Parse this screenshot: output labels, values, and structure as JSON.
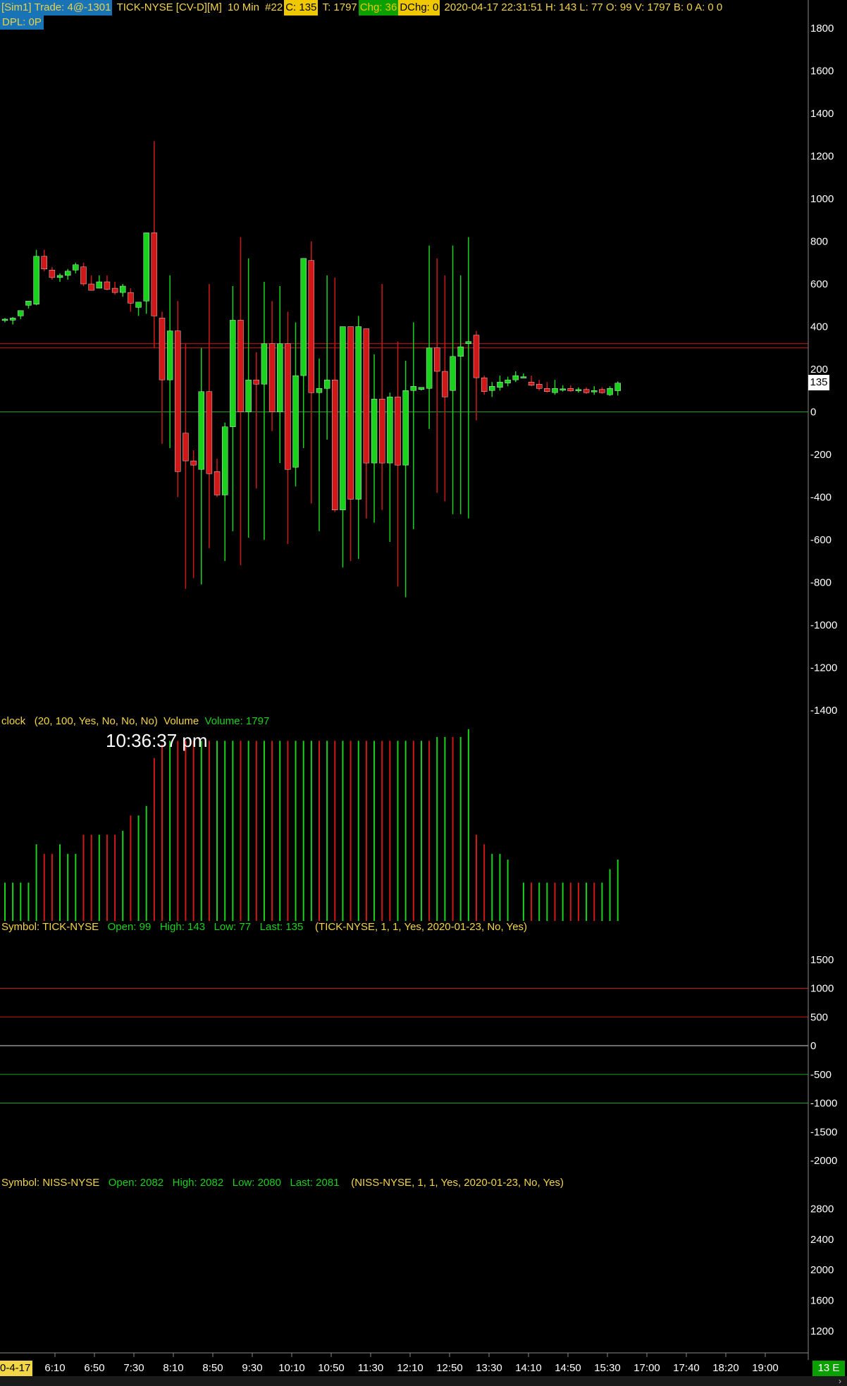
{
  "topbar": {
    "account": "[Sim1]",
    "trade": "Trade: 4@-1301",
    "symbol": "TICK-NYSE [CV-D][M]",
    "interval": "10 Min",
    "bar_number": "#22",
    "close": "C: 135",
    "ticks": "T: 1797",
    "change": "Chg: 36",
    "dchange": "DChg: 0",
    "stats": "2020-04-17 22:31:51 H: 143 L: 77 O: 99 V: 1797 B: 0 A: 0 0"
  },
  "dpl": "DPL: 0P",
  "price_axis": [
    "1800",
    "1600",
    "1400",
    "1200",
    "1000",
    "800",
    "600",
    "400",
    "200",
    "0",
    "-200",
    "-400",
    "-600",
    "-800",
    "-1000",
    "-1200",
    "-1400"
  ],
  "last_price_badge": "135",
  "volume_panel": {
    "label_name": "clock",
    "label_params": "(20, 100, Yes, No, No, No)",
    "label_volume": "Volume",
    "label_value": "Volume: 1797",
    "clock_time": "10:36:37 pm"
  },
  "tick_panel": {
    "label_symbol": "Symbol: TICK-NYSE",
    "label_open": "Open: 99",
    "label_high": "High: 143",
    "label_low": "Low: 77",
    "label_last": "Last: 135",
    "label_params": "(TICK-NYSE, 1, 1, Yes, 2020-01-23, No, Yes)",
    "axis": [
      "1500",
      "1000",
      "500",
      "0",
      "-500",
      "-1000",
      "-1500",
      "-2000"
    ]
  },
  "niss_panel": {
    "label_symbol": "Symbol: NISS-NYSE",
    "label_open": "Open: 2082",
    "label_high": "High: 2082",
    "label_low": "Low: 2080",
    "label_last": "Last: 2081",
    "label_params": "(NISS-NYSE, 1, 1, Yes, 2020-01-23, No, Yes)",
    "axis": [
      "2800",
      "2400",
      "2000",
      "1600",
      "1200"
    ]
  },
  "time_axis": [
    "6:10",
    "6:50",
    "7:30",
    "8:10",
    "8:50",
    "9:30",
    "10:10",
    "10:50",
    "11:30",
    "12:10",
    "12:50",
    "13:30",
    "14:10",
    "14:50",
    "15:30",
    "17:00",
    "17:40",
    "18:20",
    "19:00"
  ],
  "date_badge": "0-4-17",
  "scroll_badge": "13 E",
  "colors": {
    "up": "#19d21c",
    "down": "#d01818",
    "grid_red": "#d01818",
    "grid_green": "#19a01c",
    "axis_text": "#ffffff"
  },
  "chart_data": {
    "type": "candlestick",
    "ylim": [
      -1400,
      1800
    ],
    "candles": [
      {
        "o": 430,
        "h": 440,
        "l": 420,
        "c": 435
      },
      {
        "o": 430,
        "h": 445,
        "l": 410,
        "c": 440
      },
      {
        "o": 450,
        "h": 465,
        "l": 435,
        "c": 475
      },
      {
        "o": 500,
        "h": 520,
        "l": 485,
        "c": 520
      },
      {
        "o": 505,
        "h": 760,
        "l": 500,
        "c": 730
      },
      {
        "o": 730,
        "h": 760,
        "l": 660,
        "c": 670
      },
      {
        "o": 665,
        "h": 680,
        "l": 620,
        "c": 630
      },
      {
        "o": 630,
        "h": 650,
        "l": 610,
        "c": 640
      },
      {
        "o": 640,
        "h": 670,
        "l": 620,
        "c": 660
      },
      {
        "o": 665,
        "h": 700,
        "l": 650,
        "c": 690
      },
      {
        "o": 680,
        "h": 700,
        "l": 590,
        "c": 600
      },
      {
        "o": 600,
        "h": 640,
        "l": 580,
        "c": 570
      },
      {
        "o": 580,
        "h": 640,
        "l": 580,
        "c": 610
      },
      {
        "o": 610,
        "h": 640,
        "l": 570,
        "c": 575
      },
      {
        "o": 580,
        "h": 610,
        "l": 550,
        "c": 560
      },
      {
        "o": 560,
        "h": 600,
        "l": 540,
        "c": 590
      },
      {
        "o": 560,
        "h": 580,
        "l": 470,
        "c": 510
      },
      {
        "o": 490,
        "h": 500,
        "l": 450,
        "c": 515
      },
      {
        "o": 520,
        "h": 840,
        "l": 460,
        "c": 840
      },
      {
        "o": 840,
        "h": 1270,
        "l": 300,
        "c": 450
      },
      {
        "o": 440,
        "h": 470,
        "l": -150,
        "c": 150
      },
      {
        "o": 150,
        "h": 640,
        "l": -170,
        "c": 380
      },
      {
        "o": 380,
        "h": 520,
        "l": -400,
        "c": -280
      },
      {
        "o": -100,
        "h": 320,
        "l": -830,
        "c": -230
      },
      {
        "o": -230,
        "h": -180,
        "l": -780,
        "c": -250
      },
      {
        "o": -270,
        "h": 300,
        "l": -810,
        "c": 95
      },
      {
        "o": 95,
        "h": 600,
        "l": -640,
        "c": -290
      },
      {
        "o": -280,
        "h": -220,
        "l": -400,
        "c": -390
      },
      {
        "o": -390,
        "h": -50,
        "l": -700,
        "c": -70
      },
      {
        "o": -70,
        "h": 590,
        "l": -560,
        "c": 430
      },
      {
        "o": 430,
        "h": 820,
        "l": -720,
        "c": 0
      },
      {
        "o": 0,
        "h": 720,
        "l": -590,
        "c": 150
      },
      {
        "o": 150,
        "h": 280,
        "l": -360,
        "c": 130
      },
      {
        "o": 130,
        "h": 610,
        "l": -600,
        "c": 320
      },
      {
        "o": 320,
        "h": 520,
        "l": -90,
        "c": 0
      },
      {
        "o": 0,
        "h": 590,
        "l": -240,
        "c": 320
      },
      {
        "o": 320,
        "h": 470,
        "l": -620,
        "c": -270
      },
      {
        "o": -260,
        "h": 420,
        "l": -350,
        "c": 170
      },
      {
        "o": 170,
        "h": 720,
        "l": -170,
        "c": 720
      },
      {
        "o": 710,
        "h": 800,
        "l": -430,
        "c": 90
      },
      {
        "o": 90,
        "h": 250,
        "l": -560,
        "c": 110
      },
      {
        "o": 110,
        "h": 640,
        "l": -130,
        "c": 150
      },
      {
        "o": 150,
        "h": 630,
        "l": -470,
        "c": -460
      },
      {
        "o": -460,
        "h": 140,
        "l": -730,
        "c": 400
      },
      {
        "o": 400,
        "h": 360,
        "l": -700,
        "c": -410
      },
      {
        "o": -410,
        "h": 450,
        "l": -690,
        "c": 400
      },
      {
        "o": 390,
        "h": 380,
        "l": -500,
        "c": -240
      },
      {
        "o": -240,
        "h": 270,
        "l": -520,
        "c": 60
      },
      {
        "o": 60,
        "h": 600,
        "l": -460,
        "c": -240
      },
      {
        "o": -240,
        "h": 90,
        "l": -610,
        "c": 70
      },
      {
        "o": 70,
        "h": 330,
        "l": -820,
        "c": -250
      },
      {
        "o": -250,
        "h": 240,
        "l": -870,
        "c": 100
      },
      {
        "o": 100,
        "h": 420,
        "l": -550,
        "c": 120
      },
      {
        "o": 105,
        "h": 110,
        "l": 100,
        "c": 115
      },
      {
        "o": 110,
        "h": 780,
        "l": -80,
        "c": 300
      },
      {
        "o": 300,
        "h": 720,
        "l": -380,
        "c": 190
      },
      {
        "o": 190,
        "h": 640,
        "l": -420,
        "c": 70
      },
      {
        "o": 100,
        "h": 780,
        "l": -480,
        "c": 260
      },
      {
        "o": 260,
        "h": 640,
        "l": -480,
        "c": 305
      },
      {
        "o": 320,
        "h": 820,
        "l": -500,
        "c": 330
      },
      {
        "o": 360,
        "h": 380,
        "l": -40,
        "c": 160
      },
      {
        "o": 160,
        "h": 170,
        "l": 80,
        "c": 95
      },
      {
        "o": 100,
        "h": 140,
        "l": 70,
        "c": 120
      },
      {
        "o": 115,
        "h": 170,
        "l": 100,
        "c": 140
      },
      {
        "o": 135,
        "h": 165,
        "l": 120,
        "c": 150
      },
      {
        "o": 150,
        "h": 190,
        "l": 140,
        "c": 170
      },
      {
        "o": 165,
        "h": 180,
        "l": 160,
        "c": 165
      },
      {
        "o": 140,
        "h": 170,
        "l": 120,
        "c": 125
      },
      {
        "o": 130,
        "h": 150,
        "l": 100,
        "c": 110
      },
      {
        "o": 110,
        "h": 140,
        "l": 90,
        "c": 95
      },
      {
        "o": 90,
        "h": 150,
        "l": 80,
        "c": 110
      },
      {
        "o": 105,
        "h": 125,
        "l": 95,
        "c": 108
      },
      {
        "o": 110,
        "h": 125,
        "l": 95,
        "c": 98
      },
      {
        "o": 100,
        "h": 115,
        "l": 90,
        "c": 105
      },
      {
        "o": 105,
        "h": 115,
        "l": 85,
        "c": 90
      },
      {
        "o": 95,
        "h": 120,
        "l": 80,
        "c": 100
      },
      {
        "o": 105,
        "h": 115,
        "l": 85,
        "c": 90
      },
      {
        "o": 80,
        "h": 120,
        "l": 75,
        "c": 110
      },
      {
        "o": 99,
        "h": 143,
        "l": 77,
        "c": 135
      }
    ],
    "reference_lines": [
      320,
      300,
      0
    ],
    "volume": [
      {
        "v": 0.2,
        "up": true
      },
      {
        "v": 0.2,
        "up": true
      },
      {
        "v": 0.2,
        "up": true
      },
      {
        "v": 0.2,
        "up": true
      },
      {
        "v": 0.4,
        "up": true
      },
      {
        "v": 0.35,
        "up": false
      },
      {
        "v": 0.35,
        "up": false
      },
      {
        "v": 0.4,
        "up": true
      },
      {
        "v": 0.35,
        "up": true
      },
      {
        "v": 0.35,
        "up": true
      },
      {
        "v": 0.45,
        "up": false
      },
      {
        "v": 0.45,
        "up": false
      },
      {
        "v": 0.45,
        "up": true
      },
      {
        "v": 0.45,
        "up": false
      },
      {
        "v": 0.45,
        "up": false
      },
      {
        "v": 0.47,
        "up": true
      },
      {
        "v": 0.55,
        "up": false
      },
      {
        "v": 0.55,
        "up": true
      },
      {
        "v": 0.6,
        "up": true
      },
      {
        "v": 0.85,
        "up": false
      },
      {
        "v": 0.92,
        "up": false
      },
      {
        "v": 0.94,
        "up": true
      },
      {
        "v": 0.94,
        "up": false
      },
      {
        "v": 0.94,
        "up": false
      },
      {
        "v": 0.94,
        "up": false
      },
      {
        "v": 0.94,
        "up": true
      },
      {
        "v": 0.94,
        "up": false
      },
      {
        "v": 0.94,
        "up": true
      },
      {
        "v": 0.94,
        "up": true
      },
      {
        "v": 0.94,
        "up": true
      },
      {
        "v": 0.94,
        "up": false
      },
      {
        "v": 0.94,
        "up": true
      },
      {
        "v": 0.94,
        "up": false
      },
      {
        "v": 0.94,
        "up": true
      },
      {
        "v": 0.94,
        "up": false
      },
      {
        "v": 0.94,
        "up": true
      },
      {
        "v": 0.94,
        "up": false
      },
      {
        "v": 0.94,
        "up": true
      },
      {
        "v": 0.94,
        "up": true
      },
      {
        "v": 0.94,
        "up": true
      },
      {
        "v": 0.94,
        "up": false
      },
      {
        "v": 0.94,
        "up": true
      },
      {
        "v": 0.94,
        "up": false
      },
      {
        "v": 0.94,
        "up": true
      },
      {
        "v": 0.94,
        "up": false
      },
      {
        "v": 0.94,
        "up": true
      },
      {
        "v": 0.94,
        "up": false
      },
      {
        "v": 0.94,
        "up": true
      },
      {
        "v": 0.94,
        "up": false
      },
      {
        "v": 0.94,
        "up": false
      },
      {
        "v": 0.94,
        "up": true
      },
      {
        "v": 0.94,
        "up": true
      },
      {
        "v": 0.94,
        "up": false
      },
      {
        "v": 0.94,
        "up": true
      },
      {
        "v": 0.94,
        "up": false
      },
      {
        "v": 0.96,
        "up": true
      },
      {
        "v": 0.96,
        "up": true
      },
      {
        "v": 0.96,
        "up": false
      },
      {
        "v": 0.96,
        "up": true
      },
      {
        "v": 1.0,
        "up": true
      },
      {
        "v": 0.45,
        "up": false
      },
      {
        "v": 0.4,
        "up": false
      },
      {
        "v": 0.35,
        "up": true
      },
      {
        "v": 0.35,
        "up": true
      },
      {
        "v": 0.32,
        "up": true
      },
      {
        "v": 0.0,
        "up": true
      },
      {
        "v": 0.2,
        "up": true
      },
      {
        "v": 0.2,
        "up": false
      },
      {
        "v": 0.2,
        "up": true
      },
      {
        "v": 0.2,
        "up": true
      },
      {
        "v": 0.2,
        "up": false
      },
      {
        "v": 0.2,
        "up": true
      },
      {
        "v": 0.2,
        "up": false
      },
      {
        "v": 0.2,
        "up": false
      },
      {
        "v": 0.2,
        "up": true
      },
      {
        "v": 0.2,
        "up": false
      },
      {
        "v": 0.2,
        "up": true
      },
      {
        "v": 0.27,
        "up": true
      },
      {
        "v": 0.32,
        "up": true
      }
    ],
    "tick_levels": [
      {
        "value": 1000,
        "color": "red"
      },
      {
        "value": 500,
        "color": "red"
      },
      {
        "value": 0,
        "color": "white"
      },
      {
        "value": -500,
        "color": "green"
      },
      {
        "value": -1000,
        "color": "green"
      }
    ]
  }
}
